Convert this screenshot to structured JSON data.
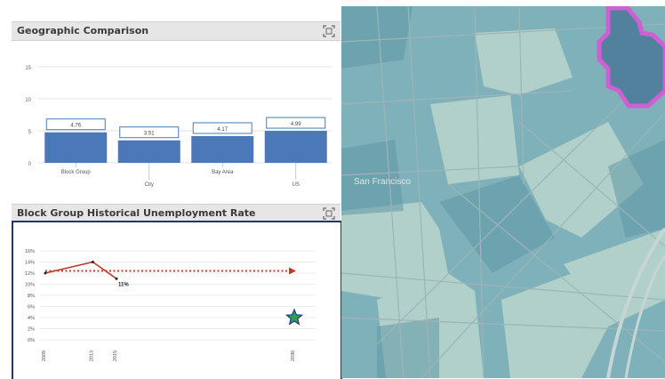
{
  "panels": {
    "geo": {
      "title": "Geographic Comparison"
    },
    "hist": {
      "title": "Block Group Historical Unemployment Rate"
    }
  },
  "chart_data": [
    {
      "type": "bar",
      "title": "",
      "categories": [
        "Block Group",
        "City",
        "Bay Area",
        "US"
      ],
      "values": [
        4.76,
        3.51,
        4.17,
        4.99
      ],
      "value_labels": [
        "4.76",
        "3.51",
        "4.17",
        "4.99"
      ],
      "ylim": [
        0,
        15
      ],
      "yticks": [
        "0",
        "5",
        "10",
        "15"
      ],
      "bar_color": "#4a78b8",
      "grid": true
    },
    {
      "type": "line",
      "title": "",
      "x": [
        "2009",
        "2013",
        "2015",
        "2030"
      ],
      "ylim": [
        0,
        16
      ],
      "yticks": [
        "0%",
        "2%",
        "4%",
        "6%",
        "8%",
        "10%",
        "12%",
        "14%",
        "16%"
      ],
      "series": [
        {
          "points": [
            {
              "x": 2009,
              "y": 12
            },
            {
              "x": 2013,
              "y": 14
            },
            {
              "x": 2015,
              "y": 11
            }
          ],
          "color": "#c0392b",
          "style": "solid"
        },
        {
          "points": [
            {
              "x": 2009,
              "y": 12.4
            },
            {
              "x": 2030,
              "y": 12.4
            }
          ],
          "color": "#c0392b",
          "style": "dotted"
        }
      ],
      "marker": {
        "x": 2030,
        "y": 4,
        "shape": "star-icon",
        "color": "#2e9e4f"
      },
      "annotation": "11%"
    }
  ],
  "map": {
    "area_label": "San Francisco"
  }
}
